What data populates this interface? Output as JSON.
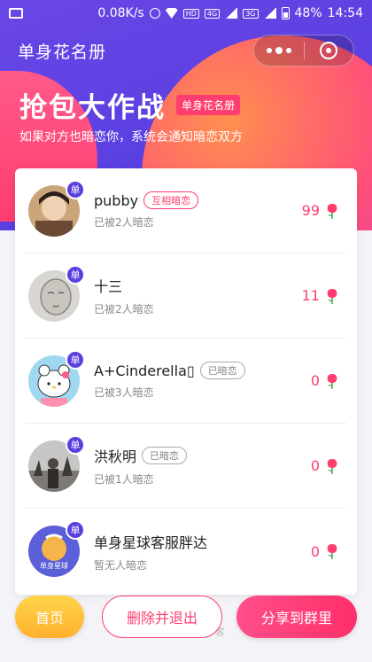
{
  "status_bar": {
    "network_speed": "0.08K/s",
    "hd_label": "HD",
    "net_4g": "4G",
    "net_3g": "3G",
    "battery": "48%",
    "time": "14:54"
  },
  "nav": {
    "title": "单身花名册"
  },
  "hero": {
    "title": "抢包大作战",
    "tag": "单身花名册",
    "subtitle": "如果对方也暗恋你，系统会通知暗恋双方"
  },
  "single_badge": "单",
  "list": [
    {
      "name": "pubby",
      "status": "互相暗恋",
      "status_type": "mutual",
      "sub": "已被2人暗恋",
      "count": "99"
    },
    {
      "name": "十三",
      "status": "",
      "status_type": "",
      "sub": "已被2人暗恋",
      "count": "11"
    },
    {
      "name": "A+Cinderella▯",
      "status": "已暗恋",
      "status_type": "done",
      "sub": "已被3人暗恋",
      "count": "0"
    },
    {
      "name": "洪秋明",
      "status": "已暗恋",
      "status_type": "done",
      "sub": "已被1人暗恋",
      "count": "0"
    },
    {
      "name": "单身星球客服胖达",
      "status": "",
      "status_type": "",
      "sub": "暂无人暗恋",
      "count": "0"
    }
  ],
  "avatar_text": "单身星球",
  "buttons": {
    "home": "首页",
    "delete": "删除并退出",
    "share": "分享到群里"
  },
  "under_text": "客",
  "colors": {
    "brand_purple": "#5a3fe0",
    "accent_pink": "#ff3d6e",
    "home_yellow": "#ffc23a"
  }
}
